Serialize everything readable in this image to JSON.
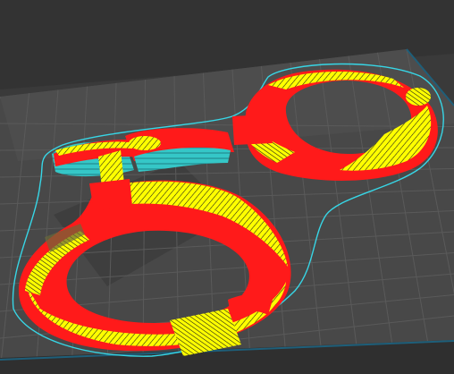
{
  "viewport": {
    "kind": "slicer-3d-layer-preview",
    "colors": {
      "background": "#3a3a3a",
      "build_plate": "#484848",
      "grid_lines": "#5a5a5a",
      "plate_border": "#1e5f7a",
      "wall": "#ff1a1a",
      "infill": "#ffff00",
      "support": "#35c7c7",
      "skirt": "#37d6e6",
      "shadow_region": "#2e2e2e"
    },
    "feature_types": [
      "wall",
      "infill",
      "support",
      "skirt"
    ]
  }
}
